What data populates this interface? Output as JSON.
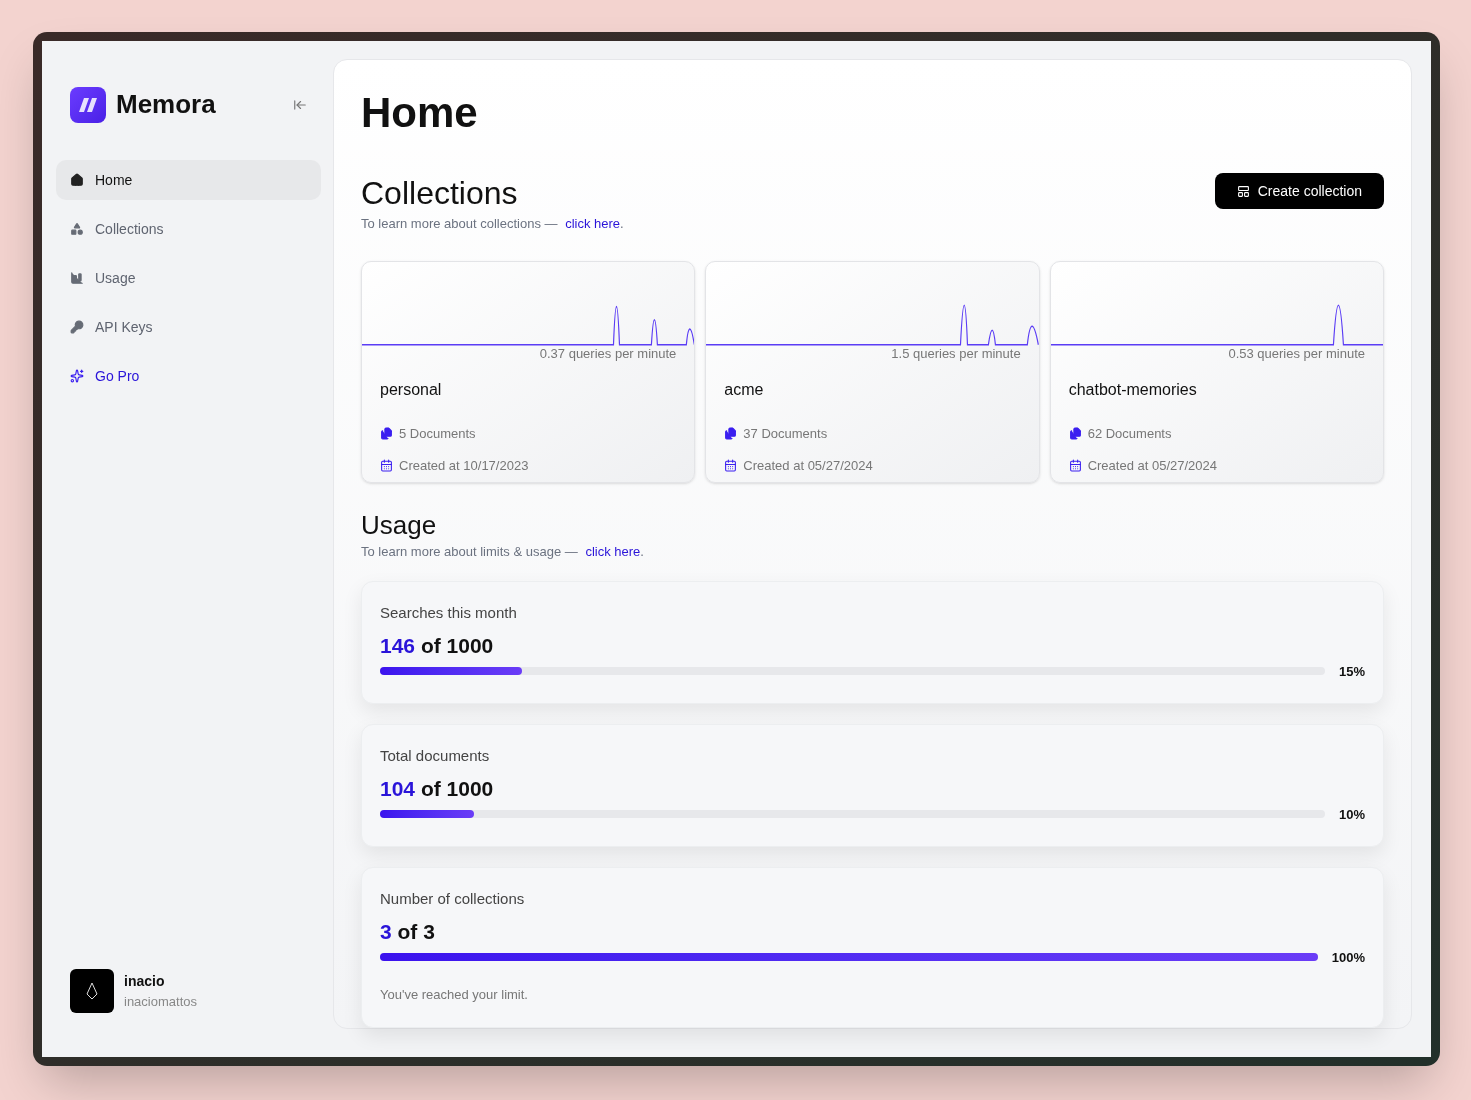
{
  "sidebar": {
    "brand": "Memora",
    "nav": [
      {
        "label": "Home",
        "kind": "link",
        "selected": true
      },
      {
        "label": "Collections",
        "kind": "link",
        "selected": false
      },
      {
        "label": "Usage",
        "kind": "link",
        "selected": false
      },
      {
        "label": "API Keys",
        "kind": "link",
        "selected": false
      },
      {
        "label": "Go Pro",
        "kind": "promo",
        "selected": false
      }
    ],
    "user": {
      "name": "inacio",
      "handle": "inaciomattos"
    }
  },
  "page_title": "Home",
  "collections": {
    "title": "Collections",
    "hint": "To learn more about collections —",
    "link": "click here",
    "hint_end": ".",
    "button": "Create collection",
    "cards": [
      {
        "rate": "0.37 queries per minute",
        "name": "personal",
        "documents": "5 Documents",
        "created": "Created at 10/17/2023"
      },
      {
        "rate": "1.5 queries per minute",
        "name": "acme",
        "documents": "37 Documents",
        "created": "Created at 05/27/2024"
      },
      {
        "rate": "0.53 queries per minute",
        "name": "chatbot-memories",
        "documents": "62 Documents",
        "created": "Created at 05/27/2024"
      }
    ]
  },
  "usage": {
    "title": "Usage",
    "hint": "To learn more about limits & usage —",
    "link": "click here",
    "hint_end": ".",
    "meters": [
      {
        "label": "Searches this month",
        "count": "146",
        "limit": "of 1000",
        "level": 0.15,
        "reading": "15%"
      },
      {
        "label": "Total documents",
        "count": "104",
        "limit": "of 1000",
        "level": 0.1,
        "reading": "10%"
      },
      {
        "label": "Number of collections",
        "count": "3",
        "limit": "of 3",
        "level": 1,
        "reading": "100%",
        "note": "You've reached your limit."
      }
    ]
  }
}
